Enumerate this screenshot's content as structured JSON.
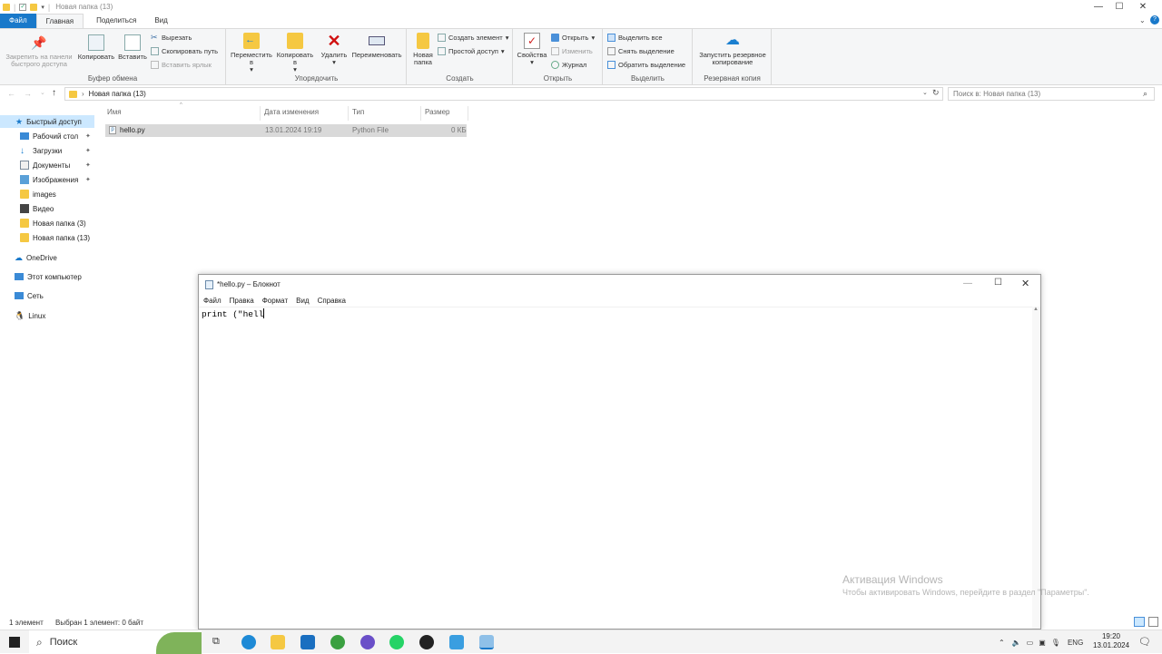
{
  "explorer": {
    "title": "Новая папка (13)",
    "tabs": {
      "file": "Файл",
      "home": "Главная",
      "share": "Поделиться",
      "view": "Вид"
    },
    "ribbon": {
      "clipboard": {
        "label": "Буфер обмена",
        "pin": "Закрепить на панели быстрого доступа",
        "copy": "Копировать",
        "paste": "Вставить",
        "cut": "Вырезать",
        "copy_path": "Скопировать путь",
        "paste_shortcut": "Вставить ярлык"
      },
      "organize": {
        "label": "Упорядочить",
        "move": "Переместить в",
        "copy_to": "Копировать в",
        "delete": "Удалить",
        "rename": "Переименовать"
      },
      "new": {
        "label": "Создать",
        "new_folder": "Новая папка",
        "new_item": "Создать элемент",
        "easy_access": "Простой доступ"
      },
      "open": {
        "label": "Открыть",
        "properties": "Свойства",
        "open": "Открыть",
        "edit": "Изменить",
        "history": "Журнал"
      },
      "select": {
        "label": "Выделить",
        "select_all": "Выделить все",
        "select_none": "Снять выделение",
        "invert": "Обратить выделение"
      },
      "backup": {
        "label": "Резервная копия",
        "start_backup": "Запустить резервное копирование"
      }
    },
    "address": "Новая папка (13)",
    "search_placeholder": "Поиск в: Новая папка (13)",
    "nav": [
      {
        "label": "Быстрый доступ",
        "pinned": false
      },
      {
        "label": "Рабочий стол",
        "pinned": true
      },
      {
        "label": "Загрузки",
        "pinned": true
      },
      {
        "label": "Документы",
        "pinned": true
      },
      {
        "label": "Изображения",
        "pinned": true
      },
      {
        "label": "images",
        "pinned": false
      },
      {
        "label": "Видео",
        "pinned": false
      },
      {
        "label": "Новая папка (3)",
        "pinned": false
      },
      {
        "label": "Новая папка (13)",
        "pinned": false
      },
      {
        "label": "OneDrive",
        "pinned": false
      },
      {
        "label": "Этот компьютер",
        "pinned": false
      },
      {
        "label": "Сеть",
        "pinned": false
      },
      {
        "label": "Linux",
        "pinned": false
      }
    ],
    "columns": {
      "name": "Имя",
      "date": "Дата изменения",
      "type": "Тип",
      "size": "Размер"
    },
    "files": [
      {
        "name": "hello.py",
        "date": "13.01.2024 19:19",
        "type": "Python File",
        "size": "0 КБ"
      }
    ],
    "status": {
      "count": "1 элемент",
      "selected": "Выбран 1 элемент: 0 байт"
    }
  },
  "notepad": {
    "title": "*hello.py – Блокнот",
    "menu": [
      "Файл",
      "Правка",
      "Формат",
      "Вид",
      "Справка"
    ],
    "content": "print (\"hell"
  },
  "watermark": {
    "line1": "Активация Windows",
    "line2": "Чтобы активировать Windows, перейдите в раздел \"Параметры\"."
  },
  "taskbar": {
    "search": "Поиск",
    "lang": "ENG",
    "time": "19:20",
    "date": "13.01.2024"
  },
  "colors": {
    "accent": "#1979ca",
    "selection": "#cce8ff",
    "folder": "#f5c842"
  }
}
